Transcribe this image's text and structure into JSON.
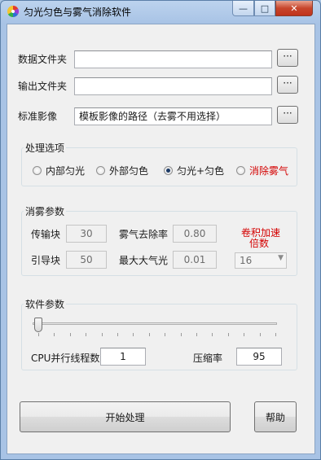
{
  "window": {
    "title": "匀光匀色与雾气消除软件",
    "icon": "color-wheel-icon",
    "controls": {
      "minimize": "—",
      "maximize": "□",
      "close": "✕"
    }
  },
  "paths": {
    "data_folder_label": "数据文件夹",
    "data_folder_value": "",
    "output_folder_label": "输出文件夹",
    "output_folder_value": "",
    "standard_image_label": "标准影像",
    "standard_image_value": "模板影像的路径（去雾不用选择）",
    "browse_label": "···"
  },
  "processing_options": {
    "title": "处理选项",
    "options": [
      {
        "label": "内部匀光",
        "checked": false
      },
      {
        "label": "外部匀色",
        "checked": false
      },
      {
        "label": "匀光+匀色",
        "checked": true
      },
      {
        "label": "消除雾气",
        "checked": false,
        "color": "#d40000"
      }
    ]
  },
  "dehaze_params": {
    "title": "消雾参数",
    "transfer_block_label": "传输块",
    "transfer_block_value": "30",
    "haze_removal_label": "雾气去除率",
    "haze_removal_value": "0.80",
    "guide_block_label": "引导块",
    "guide_block_value": "50",
    "max_atmos_label": "最大大气光",
    "max_atmos_value": "0.01",
    "conv_accel_label_line1": "卷积加速",
    "conv_accel_label_line2": "倍数",
    "conv_accel_value": "16",
    "accent_color": "#d40000"
  },
  "software_params": {
    "title": "软件参数",
    "slider_position": 0,
    "cpu_threads_label": "CPU并行线程数",
    "cpu_threads_value": "1",
    "compression_label": "压缩率",
    "compression_value": "95"
  },
  "actions": {
    "start_label": "开始处理",
    "help_label": "帮助"
  }
}
